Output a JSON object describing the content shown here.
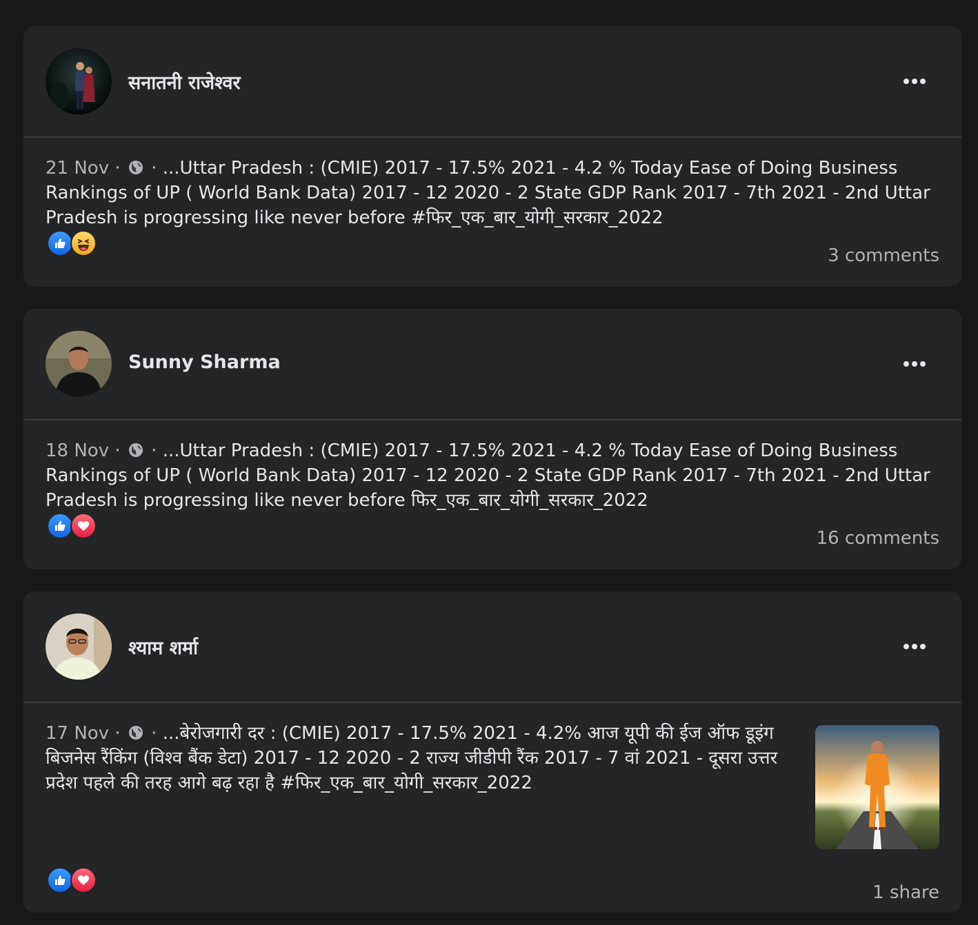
{
  "posts": [
    {
      "author": "सनातनी राजेश्वर",
      "date": "21 Nov",
      "separator": "·",
      "text": "...Uttar Pradesh : (CMIE) 2017 - 17.5% 2021 - 4.2 % Today Ease of Doing Business Rankings of UP ( World Bank Data) 2017 - 12 2020 - 2 State GDP Rank 2017 - 7th 2021 - 2nd Uttar Pradesh is progressing like never before #फिर_एक_बार_योगी_सरकार_2022",
      "reactions": [
        "like-icon",
        "haha-icon"
      ],
      "engagement": "3 comments"
    },
    {
      "author": "Sunny Sharma",
      "date": "18 Nov",
      "separator": "·",
      "text": "...Uttar Pradesh : (CMIE) 2017 - 17.5% 2021 - 4.2 % Today Ease of Doing Business Rankings of UP ( World Bank Data) 2017 - 12 2020 - 2 State GDP Rank 2017 - 7th 2021 - 2nd Uttar Pradesh is progressing like never before फिर_एक_बार_योगी_सरकार_2022",
      "reactions": [
        "like-icon",
        "love-icon"
      ],
      "engagement": "16 comments"
    },
    {
      "author": "श्याम शर्मा",
      "date": "17 Nov",
      "separator": "·",
      "text": "...बेरोजगारी दर : (CMIE) 2017 - 17.5% 2021 - 4.2% आज यूपी की ईज ऑफ डूइंग बिजनेस रैंकिंग (विश्व बैंक डेटा) 2017 - 12 2020 - 2 राज्य जीडीपी रैंक 2017 - 7 वां 2021 - दूसरा उत्तर प्रदेश पहले की तरह आगे बढ़ रहा है #फिर_एक_बार_योगी_सरकार_2022",
      "reactions": [
        "like-icon",
        "love-icon"
      ],
      "engagement": "1 share"
    }
  ],
  "icons": {
    "more": "more-options-icon",
    "privacy": "globe-icon"
  },
  "colors": {
    "background": "#18191a",
    "card": "#242526",
    "divider": "#3a3b3c",
    "text_primary": "#e4e6eb",
    "text_secondary": "#b0b3b8",
    "like": "#1877f2",
    "love": "#e41e3f",
    "haha": "#f7b928"
  }
}
